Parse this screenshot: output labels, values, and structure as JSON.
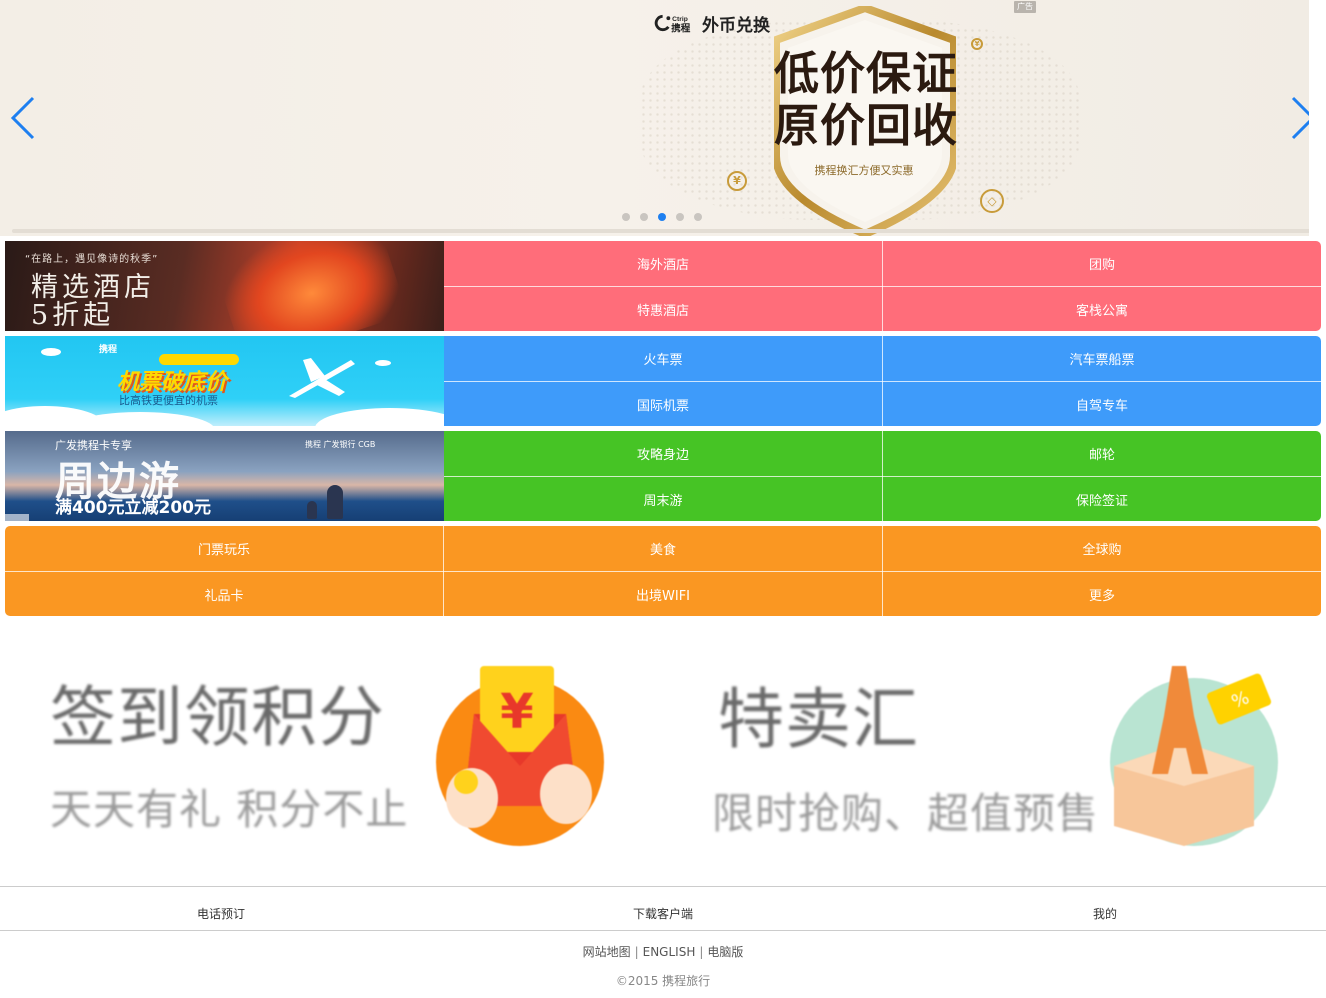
{
  "banner": {
    "brand_logo": "Ctrip 携程",
    "brand_text": "外币兑换",
    "ad_badge": "广告",
    "headline_1": "低价保证",
    "headline_2": "原价回收",
    "subline": "携程换汇方便又实惠",
    "slide_count": 5,
    "active_slide": 3,
    "prev_icon": "chevron-left-icon",
    "next_icon": "chevron-right-icon",
    "accent_color": "#1e7ff0"
  },
  "rows": {
    "hotel": {
      "promo": {
        "quote": "“在路上，遇见像诗的秋季”",
        "line1": "精选酒店",
        "line2": "5折起"
      },
      "items": [
        "海外酒店",
        "团购",
        "特惠酒店",
        "客栈公寓"
      ],
      "color": "#ff6d7a"
    },
    "flight": {
      "promo": {
        "logo": "携程",
        "title": "机票破底价",
        "sub": "比高铁更便宜的机票"
      },
      "items": [
        "火车票",
        "汽车票船票",
        "国际机票",
        "自驾专车"
      ],
      "color": "#3e9bfa"
    },
    "travel": {
      "promo": {
        "top": "广发携程卡专享",
        "big": "周边游",
        "deal": "满400元立减200元",
        "logos": "携程  广发银行 CGB"
      },
      "items": [
        "攻略身边",
        "邮轮",
        "周末游",
        "保险签证"
      ],
      "color": "#46c425"
    },
    "more": {
      "items": [
        "门票玩乐",
        "美食",
        "全球购",
        "礼品卡",
        "出境WIFI",
        "更多"
      ],
      "color": "#fa9722"
    }
  },
  "promos": {
    "checkin": {
      "title": "签到领积分",
      "sub": "天天有礼 积分不止"
    },
    "sale": {
      "title": "特卖汇",
      "sub": "限时抢购、超值预售"
    }
  },
  "footer": {
    "tabs": [
      "电话预订",
      "下载客户端",
      "我的"
    ],
    "links": [
      "网站地图",
      "ENGLISH",
      "电脑版"
    ],
    "copyright": "©2015 携程旅行"
  }
}
